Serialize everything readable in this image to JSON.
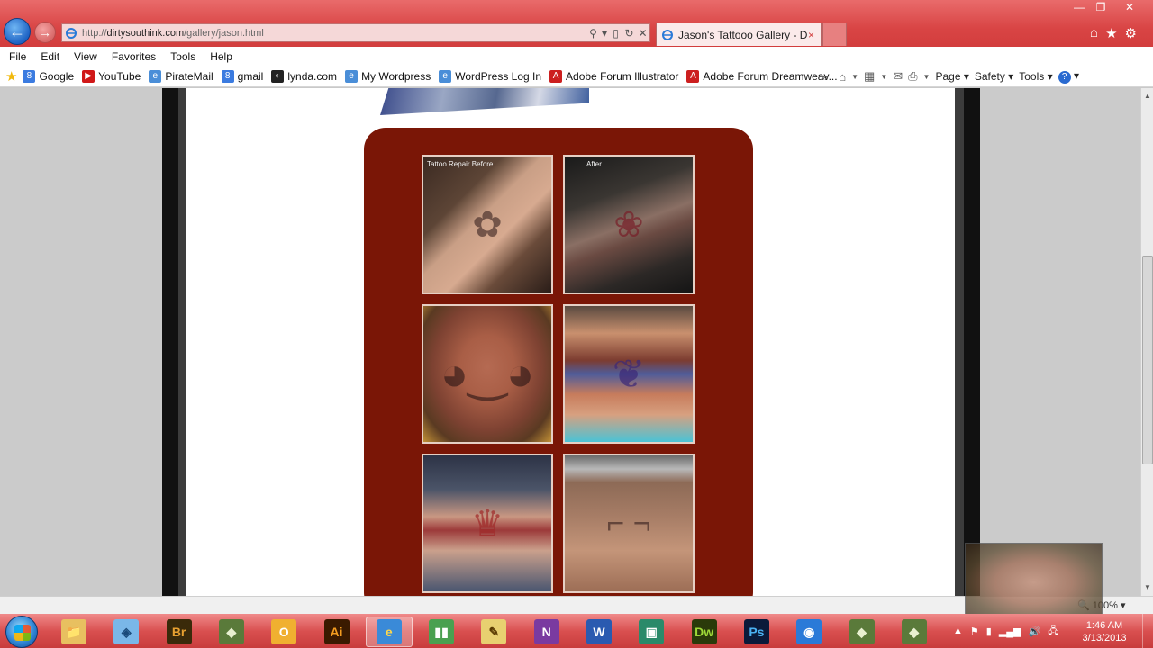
{
  "browser": {
    "address": {
      "url_prefix": "http://",
      "url_domain": "dirtysouthink.com",
      "url_path": "/gallery/jason.html"
    },
    "tab": {
      "title": "Jason's Tattooo Gallery - Di...",
      "close": "×"
    },
    "address_icons": {
      "search": "⚲",
      "compat": "▯",
      "refresh": "↻",
      "stop": "✕"
    },
    "window_controls": {
      "minimize": "—",
      "maximize": "❐",
      "close": "✕"
    },
    "right_icons": {
      "home": "⌂",
      "favorites": "★",
      "tools": "⚙"
    }
  },
  "menu": [
    "File",
    "Edit",
    "View",
    "Favorites",
    "Tools",
    "Help"
  ],
  "favorites": [
    {
      "label": "Google",
      "icon": "google-icon",
      "color": "#3b7be0",
      "glyph": "8"
    },
    {
      "label": "YouTube",
      "icon": "youtube-icon",
      "color": "#d01818",
      "glyph": "▶"
    },
    {
      "label": "PirateMail",
      "icon": "ie-page-icon",
      "color": "#4a8ed8",
      "glyph": "e"
    },
    {
      "label": "gmail",
      "icon": "google-icon",
      "color": "#3b7be0",
      "glyph": "8"
    },
    {
      "label": "lynda.com",
      "icon": "lynda-icon",
      "color": "#222222",
      "glyph": "◐"
    },
    {
      "label": "My Wordpress",
      "icon": "ie-page-icon",
      "color": "#4a8ed8",
      "glyph": "e"
    },
    {
      "label": "WordPress Log In",
      "icon": "ie-page-icon",
      "color": "#4a8ed8",
      "glyph": "e"
    },
    {
      "label": "Adobe Forum Illustrator",
      "icon": "adobe-icon",
      "color": "#cc1f1f",
      "glyph": "A"
    },
    {
      "label": "Adobe Forum Dreamweav...",
      "icon": "adobe-icon",
      "color": "#cc1f1f",
      "glyph": "A"
    }
  ],
  "more_favorites": "»",
  "commandbar": {
    "page": "Page",
    "safety": "Safety",
    "tools": "Tools",
    "help": "?"
  },
  "gallery": {
    "thumbnails": [
      {
        "caption": "Tattoo Repair Before",
        "name": "before-forearm"
      },
      {
        "caption": "After",
        "name": "after-forearm"
      },
      {
        "caption": "",
        "name": "dog-portrait"
      },
      {
        "caption": "",
        "name": "back-eagle"
      },
      {
        "caption": "",
        "name": "pinup-leg"
      },
      {
        "caption": "",
        "name": "chest-pistols"
      }
    ]
  },
  "status": {
    "zoom": "100%"
  },
  "taskbar": {
    "apps": [
      {
        "name": "explorer",
        "label": "📁",
        "bg": "#e8c060",
        "fg": "#5a3a00"
      },
      {
        "name": "network",
        "label": "◈",
        "bg": "#7ab7e8",
        "fg": "#1a4a7a"
      },
      {
        "name": "bridge",
        "label": "Br",
        "bg": "#3a2a0a",
        "fg": "#e8a030"
      },
      {
        "name": "app-green",
        "label": "◆",
        "bg": "#5a7a3a",
        "fg": "#e8f0d0"
      },
      {
        "name": "outlook",
        "label": "O",
        "bg": "#f0b030",
        "fg": "#ffffff"
      },
      {
        "name": "illustrator",
        "label": "Ai",
        "bg": "#3a1a00",
        "fg": "#f39c1f"
      },
      {
        "name": "internet-explorer",
        "label": "e",
        "bg": "#3a8ad8",
        "fg": "#ffd84a"
      },
      {
        "name": "project",
        "label": "▮▮",
        "bg": "#4aa050",
        "fg": "#ffffff"
      },
      {
        "name": "paint",
        "label": "✎",
        "bg": "#e8d070",
        "fg": "#5a3a00"
      },
      {
        "name": "onenote",
        "label": "N",
        "bg": "#7a3aa0",
        "fg": "#ffffff"
      },
      {
        "name": "word",
        "label": "W",
        "bg": "#2a5ab0",
        "fg": "#ffffff"
      },
      {
        "name": "publisher",
        "label": "▣",
        "bg": "#2a8a6a",
        "fg": "#ffffff"
      },
      {
        "name": "dreamweaver",
        "label": "Dw",
        "bg": "#2a3a0a",
        "fg": "#9ed838"
      },
      {
        "name": "photoshop",
        "label": "Ps",
        "bg": "#0a1a3a",
        "fg": "#4ab0f0"
      },
      {
        "name": "sync",
        "label": "◉",
        "bg": "#2a7ad8",
        "fg": "#ffffff"
      },
      {
        "name": "app-green-2",
        "label": "◆",
        "bg": "#5a7a3a",
        "fg": "#e8f0d0"
      },
      {
        "name": "app-green-3",
        "label": "◆",
        "bg": "#5a7a3a",
        "fg": "#e8f0d0"
      }
    ],
    "tray": {
      "up": "▲",
      "flag": "⚑",
      "battery": "▮",
      "signal": "▂▄▆",
      "volume": "🔊",
      "network": "🖧"
    },
    "clock": {
      "time": "1:46 AM",
      "date": "3/13/2013"
    }
  },
  "colors": {
    "titlebar": "#d94545",
    "gallery_bg": "#7a1606",
    "page_bg": "#ffffff"
  }
}
